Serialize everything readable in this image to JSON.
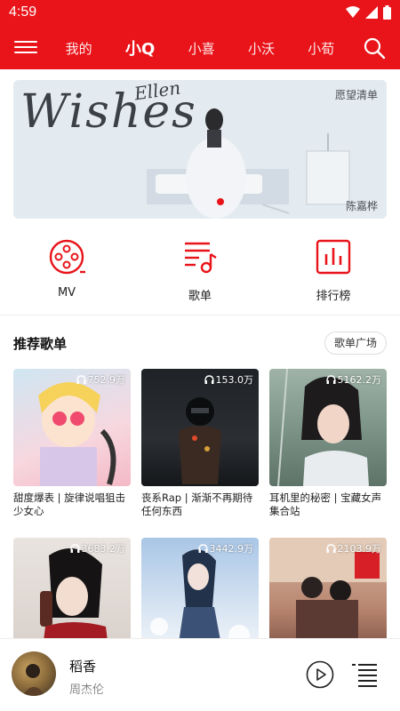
{
  "status_bar": {
    "time": "4:59"
  },
  "nav": {
    "tabs": [
      {
        "label": "我的"
      },
      {
        "label": "小Q"
      },
      {
        "label": "小喜"
      },
      {
        "label": "小沃"
      },
      {
        "label": "小荀"
      }
    ],
    "active_tab": "小Q"
  },
  "banner": {
    "title": "Wishes",
    "subtitle": "Ellen",
    "tag": "愿望清单",
    "artist": "陈嘉桦"
  },
  "quick_entries": [
    {
      "label": "MV",
      "icon": "film-reel-icon"
    },
    {
      "label": "歌单",
      "icon": "playlist-music-icon"
    },
    {
      "label": "排行榜",
      "icon": "bar-chart-icon"
    }
  ],
  "section": {
    "title": "推荐歌单",
    "more_label": "歌单广场"
  },
  "playlists": [
    {
      "count": "752.9万",
      "title": "甜度爆表 | 旋律说唱狙击少女心"
    },
    {
      "count": "153.0万",
      "title": "丧系Rap | 渐渐不再期待任何东西"
    },
    {
      "count": "5162.2万",
      "title": "耳机里的秘密 | 宝藏女声集合站"
    },
    {
      "count": "3683.2万",
      "title": ""
    },
    {
      "count": "3442.9万",
      "title": ""
    },
    {
      "count": "2103.9万",
      "title": ""
    }
  ],
  "mini_player": {
    "song": "稻香",
    "artist": "周杰伦"
  },
  "colors": {
    "brand_red": "#e8141a"
  }
}
